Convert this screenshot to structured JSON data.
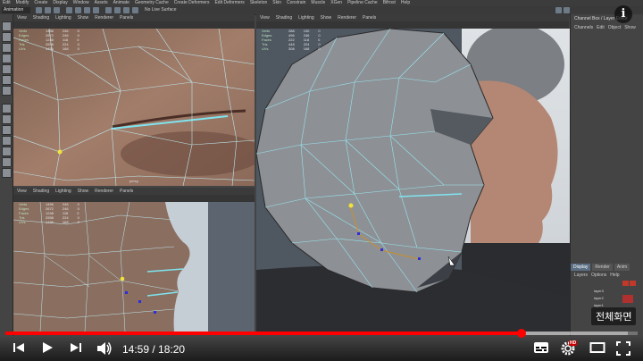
{
  "menubar": {
    "items": [
      "Edit",
      "Modify",
      "Create",
      "Display",
      "Window",
      "Assets",
      "Animate",
      "Geometry Cache",
      "Create Deformers",
      "Edit Deformers",
      "Skeleton",
      "Skin",
      "Constrain",
      "Muscle",
      "XGen",
      "Pipeline Cache",
      "Bifrost",
      "Help"
    ]
  },
  "shelf": {
    "mode": "Animation",
    "live_surface": "No Live Surface"
  },
  "panels": {
    "top_left": {
      "menu": [
        "View",
        "Shading",
        "Lighting",
        "Show",
        "Renderer",
        "Panels"
      ]
    },
    "bottom_left": {
      "menu": [
        "View",
        "Shading",
        "Lighting",
        "Show",
        "Renderer",
        "Panels"
      ],
      "camera_label": "persp"
    },
    "right": {
      "menu": [
        "View",
        "Shading",
        "Lighting",
        "Show",
        "Renderer",
        "Panels"
      ]
    }
  },
  "hud": {
    "rows": [
      {
        "key": "Verts",
        "a": "1456",
        "b": "246",
        "c": "0"
      },
      {
        "key": "Edges",
        "a": "2672",
        "b": "246",
        "c": "0"
      },
      {
        "key": "Faces",
        "a": "1248",
        "b": "118",
        "c": "0"
      },
      {
        "key": "Tris",
        "a": "2558",
        "b": "224",
        "c": "0"
      },
      {
        "key": "UVs",
        "a": "1456",
        "b": "168",
        "c": "0"
      }
    ],
    "right_rows": [
      {
        "key": "Verts",
        "a": "288",
        "b": "130",
        "c": "0"
      },
      {
        "key": "Edges",
        "a": "496",
        "b": "246",
        "c": "0"
      },
      {
        "key": "Faces",
        "a": "222",
        "b": "118",
        "c": "0"
      },
      {
        "key": "Tris",
        "a": "448",
        "b": "224",
        "c": "0"
      },
      {
        "key": "UVs",
        "a": "308",
        "b": "168",
        "c": "0"
      }
    ]
  },
  "channelbox": {
    "title": "Channel Box / Layer Editor",
    "menu": [
      "Channels",
      "Edit",
      "Object",
      "Show"
    ],
    "tabs": [
      "Display",
      "Render",
      "Anim"
    ],
    "layer_menu": [
      "Layers",
      "Options",
      "Help"
    ],
    "layers": [
      "layer3",
      "layer2",
      "layer1"
    ]
  },
  "player": {
    "time_current": "14:59",
    "time_separator": " / ",
    "time_total": "18:20",
    "progress_fraction": 0.817,
    "buffer_fraction": 0.985,
    "tooltip": "전체화면",
    "hd_badge": "HD",
    "info_label": "i",
    "colors": {
      "played": "#ff0000",
      "hd_badge": "#cc0000"
    }
  }
}
